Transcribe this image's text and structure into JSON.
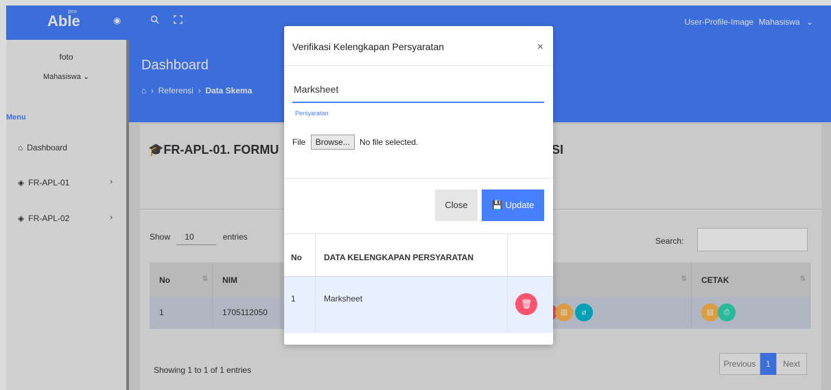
{
  "topbar": {
    "logo": "Able",
    "logo_sup": "pro",
    "user_image_alt": "User-Profile-Image",
    "user_name": "Mahasiswa",
    "user_chevron": "⌄"
  },
  "sidebar": {
    "foto": "foto",
    "user": "Mahasiswa",
    "menu_label": "Menu",
    "items": [
      {
        "label": "Dashboard",
        "icon": "home-icon"
      },
      {
        "label": "FR-APL-01",
        "icon": "layers-icon"
      },
      {
        "label": "FR-APL-02",
        "icon": "layers-icon"
      }
    ]
  },
  "header": {
    "title": "Dashboard",
    "breadcrumb": [
      "Referensi",
      "Data Skema"
    ]
  },
  "card": {
    "title": "FR-APL-01. FORMU",
    "title_tail": "SI",
    "show_label": "Show",
    "show_value": "10",
    "entries_label": "entries",
    "search_label": "Search:",
    "columns": [
      "No",
      "NIM",
      "I",
      "CETAK"
    ],
    "row": {
      "no": "1",
      "nim": "1705112050"
    },
    "showing": "Showing 1 to 1 of 1 entries",
    "pager": {
      "prev": "Previous",
      "current": "1",
      "next": "Next"
    }
  },
  "modal": {
    "title": "Verifikasi Kelengkapan Persyaratan",
    "close_x": "×",
    "input_value": "Marksheet",
    "input_label": "Persyaratan",
    "file_label": "File",
    "browse_label": "Browse...",
    "file_status": "No file selected.",
    "btn_close": "Close",
    "btn_update": "Update",
    "table": {
      "columns": [
        "No",
        "DATA KELENGKAPAN PERSYARATAN"
      ],
      "rows": [
        {
          "no": "1",
          "data": "Marksheet"
        }
      ]
    }
  },
  "colors": {
    "primary": "#4680ff",
    "danger": "#ff5370",
    "warning": "#ffb64d",
    "success": "#2ed8b6",
    "info": "#00bcd4"
  }
}
